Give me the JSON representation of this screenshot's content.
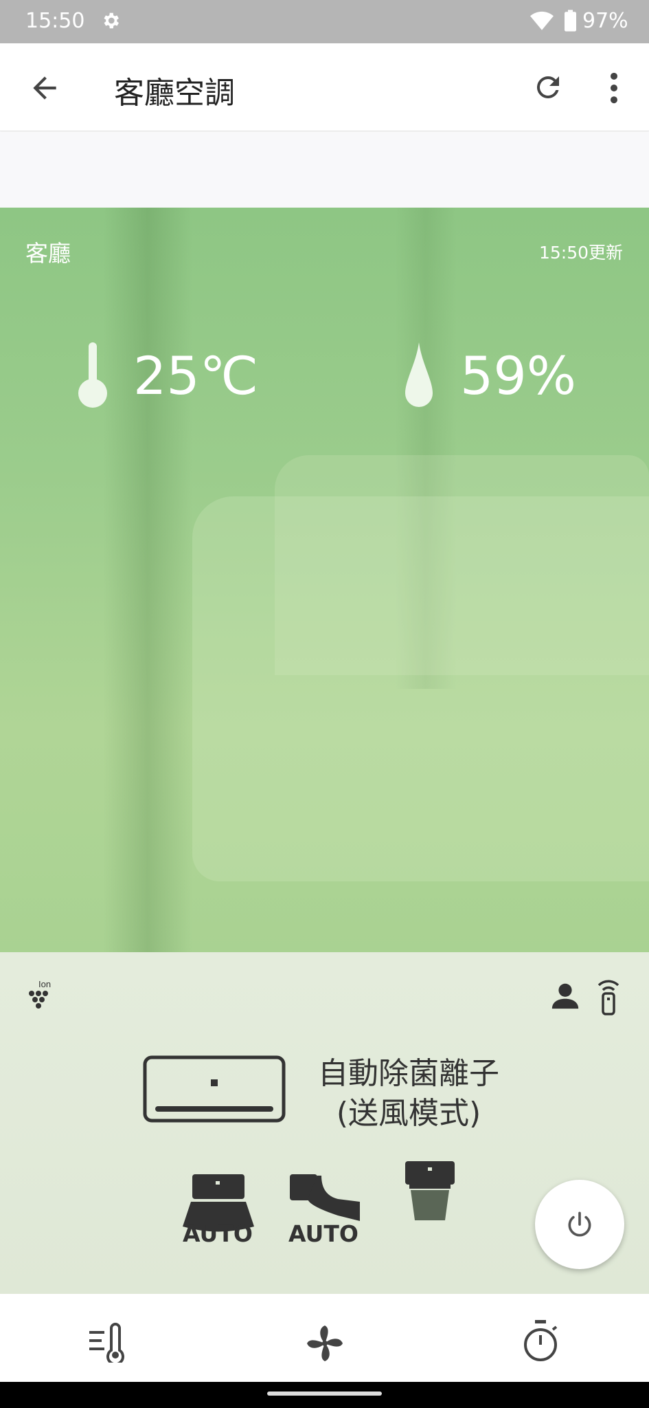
{
  "status_bar": {
    "time": "15:50",
    "battery": "97%"
  },
  "app_bar": {
    "title": "客廳空調"
  },
  "hero": {
    "room": "客廳",
    "updated": "15:50更新",
    "temperature": "25℃",
    "humidity": "59%"
  },
  "panel": {
    "mode_line1": "自動除菌離子",
    "mode_line2": "(送風模式)",
    "fan_speed_label": "AUTO",
    "vane_label": "AUTO",
    "ion_text": "Ion"
  },
  "colors": {
    "hero_green": "#9bcc8c",
    "panel_bg": "#e2ead9",
    "icon_dark": "#333333"
  }
}
